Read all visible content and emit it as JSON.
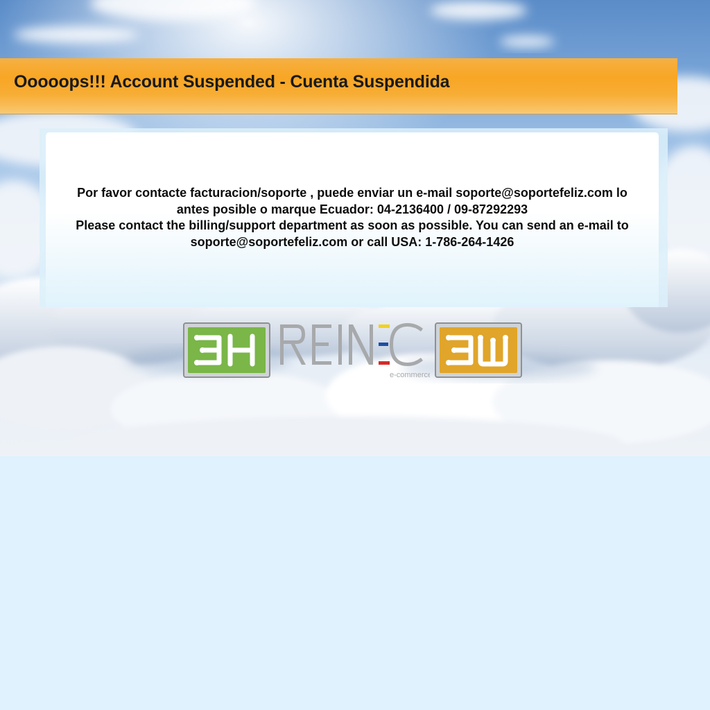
{
  "header": {
    "title": "Ooooops!!! Account Suspended - Cuenta Suspendida"
  },
  "message": {
    "lines": [
      "Por favor contacte facturacion/soporte , puede enviar un e-mail soporte@soportefeliz.com lo antes posible o marque Ecuador: 04-2136400 / 09-87292293",
      "Please contact the billing/support department as soon as possible. You can send an e-mail to soporte@soportefeliz.com or call USA: 1-786-264-1426"
    ]
  },
  "logos": {
    "left_icon": "3h-logo-icon",
    "center_wordmark": "REINEC",
    "center_tagline": "e-commerce",
    "right_icon": "3w-logo-icon"
  },
  "colors": {
    "header_orange": "#f8a624",
    "logo_green": "#7ab648",
    "logo_gold": "#e0a52a",
    "ecuador_yellow": "#f2d21b",
    "ecuador_blue": "#1f4fa3",
    "ecuador_red": "#d52a2a",
    "page_bg": "#dff2fd"
  }
}
